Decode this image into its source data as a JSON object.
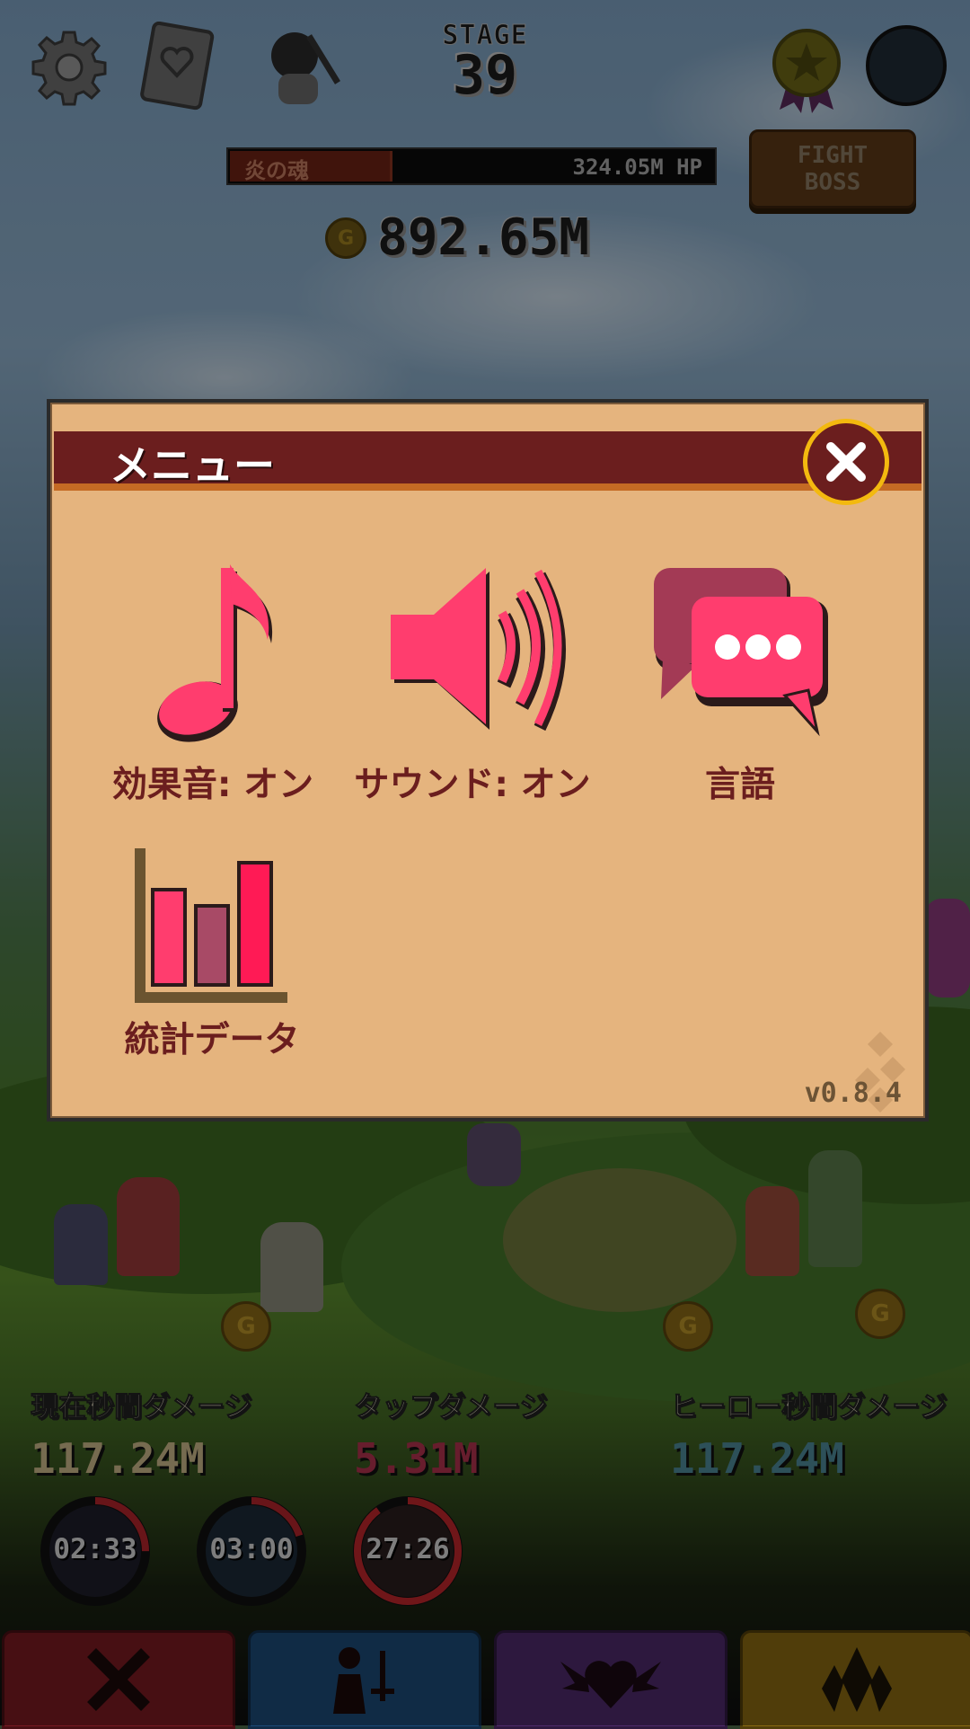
{
  "hud": {
    "settings_icon": "gear-icon",
    "album_icon": "heart-book-icon",
    "stage_label": "STAGE",
    "stage_number": "39",
    "medal_icon": "star-medal-icon",
    "profile_icon": "avatar-circle-icon"
  },
  "boss": {
    "name": "炎の魂",
    "hp_text": "324.05M HP",
    "hp_fraction": 0.33,
    "fight_button": "FIGHT\nBOSS"
  },
  "gold": {
    "coin_symbol": "G",
    "amount": "892.65M"
  },
  "menu": {
    "title": "メニュー",
    "close_icon": "close-icon",
    "items": [
      {
        "label": "効果音: オン",
        "icon": "music-note-icon"
      },
      {
        "label": "サウンド: オン",
        "icon": "speaker-icon"
      },
      {
        "label": "言語",
        "icon": "chat-bubbles-icon"
      },
      {
        "label": "統計データ",
        "icon": "bar-chart-icon"
      }
    ],
    "version": "v0.8.4"
  },
  "stats": [
    {
      "label": "現在秒間ダメージ",
      "value": "117.24M",
      "color": "#cbb98a"
    },
    {
      "label": "タップダメージ",
      "value": "5.31M",
      "color": "#b2334f"
    },
    {
      "label": "ヒーロー秒間ダメージ",
      "value": "117.24M",
      "color": "#4f8a9a"
    }
  ],
  "timers": [
    {
      "time": "02:33",
      "progress": 0.25
    },
    {
      "time": "03:00",
      "progress": 0.2
    },
    {
      "time": "27:26",
      "progress": 0.9
    }
  ],
  "nav": [
    {
      "icon": "crossed-swords-icon",
      "color": "#7a1a22"
    },
    {
      "icon": "heroes-icon",
      "color": "#1c4a78"
    },
    {
      "icon": "winged-heart-icon",
      "color": "#4f2a6b"
    },
    {
      "icon": "crystal-icon",
      "color": "#8a6a12"
    }
  ],
  "colors": {
    "menu_bg": "#e5b47e",
    "menu_header": "#6b1e1e",
    "menu_icon": "#ff3d6e",
    "close_ring": "#f3b90f"
  }
}
